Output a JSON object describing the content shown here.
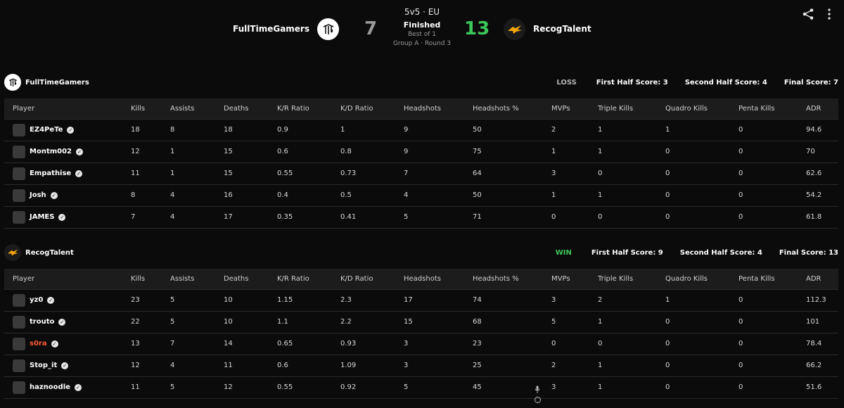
{
  "match": {
    "format": "5v5 · EU",
    "status": "Finished",
    "best_of": "Best of 1",
    "round": "Group A · Round 3",
    "team_left": "FullTimeGamers",
    "team_right": "RecogTalent",
    "score_left": "7",
    "score_right": "13"
  },
  "columns": [
    "Player",
    "Kills",
    "Assists",
    "Deaths",
    "K/R Ratio",
    "K/D Ratio",
    "Headshots",
    "Headshots %",
    "MVPs",
    "Triple Kills",
    "Quadro Kills",
    "Penta Kills",
    "ADR"
  ],
  "team1": {
    "name": "FullTimeGamers",
    "result": "LOSS",
    "first_half": "First Half Score: 3",
    "second_half": "Second Half Score: 4",
    "final": "Final Score: 7",
    "players": [
      [
        "EZ4PeTe",
        "18",
        "8",
        "18",
        "0.9",
        "1",
        "9",
        "50",
        "2",
        "1",
        "1",
        "0",
        "94.6"
      ],
      [
        "Montm002",
        "12",
        "1",
        "15",
        "0.6",
        "0.8",
        "9",
        "75",
        "1",
        "1",
        "0",
        "0",
        "70"
      ],
      [
        "Empathise",
        "11",
        "1",
        "15",
        "0.55",
        "0.73",
        "7",
        "64",
        "3",
        "0",
        "0",
        "0",
        "62.6"
      ],
      [
        "Josh",
        "8",
        "4",
        "16",
        "0.4",
        "0.5",
        "4",
        "50",
        "1",
        "1",
        "0",
        "0",
        "54.2"
      ],
      [
        "JAMES",
        "7",
        "4",
        "17",
        "0.35",
        "0.41",
        "5",
        "71",
        "0",
        "0",
        "0",
        "0",
        "61.8"
      ]
    ]
  },
  "team2": {
    "name": "RecogTalent",
    "result": "WIN",
    "first_half": "First Half Score: 9",
    "second_half": "Second Half Score: 4",
    "final": "Final Score: 13",
    "players": [
      [
        "yz0",
        "23",
        "5",
        "10",
        "1.15",
        "2.3",
        "17",
        "74",
        "3",
        "2",
        "1",
        "0",
        "112.3"
      ],
      [
        "trouto",
        "22",
        "5",
        "10",
        "1.1",
        "2.2",
        "15",
        "68",
        "5",
        "1",
        "0",
        "0",
        "101"
      ],
      [
        "s0ra",
        "13",
        "7",
        "14",
        "0.65",
        "0.93",
        "3",
        "23",
        "0",
        "0",
        "0",
        "0",
        "78.4"
      ],
      [
        "Stop_it",
        "12",
        "4",
        "11",
        "0.6",
        "1.09",
        "3",
        "25",
        "2",
        "1",
        "0",
        "0",
        "66.2"
      ],
      [
        "haznoodle",
        "11",
        "5",
        "12",
        "0.55",
        "0.92",
        "5",
        "45",
        "3",
        "1",
        "0",
        "0",
        "51.6"
      ]
    ]
  },
  "colors": {
    "win": "#3cc65a",
    "loss": "#9a9a9a",
    "highlight_player": "#ff5a36"
  },
  "icons": {
    "share": "share-icon",
    "more": "more-vertical-icon",
    "verified": "verified-check-icon"
  }
}
